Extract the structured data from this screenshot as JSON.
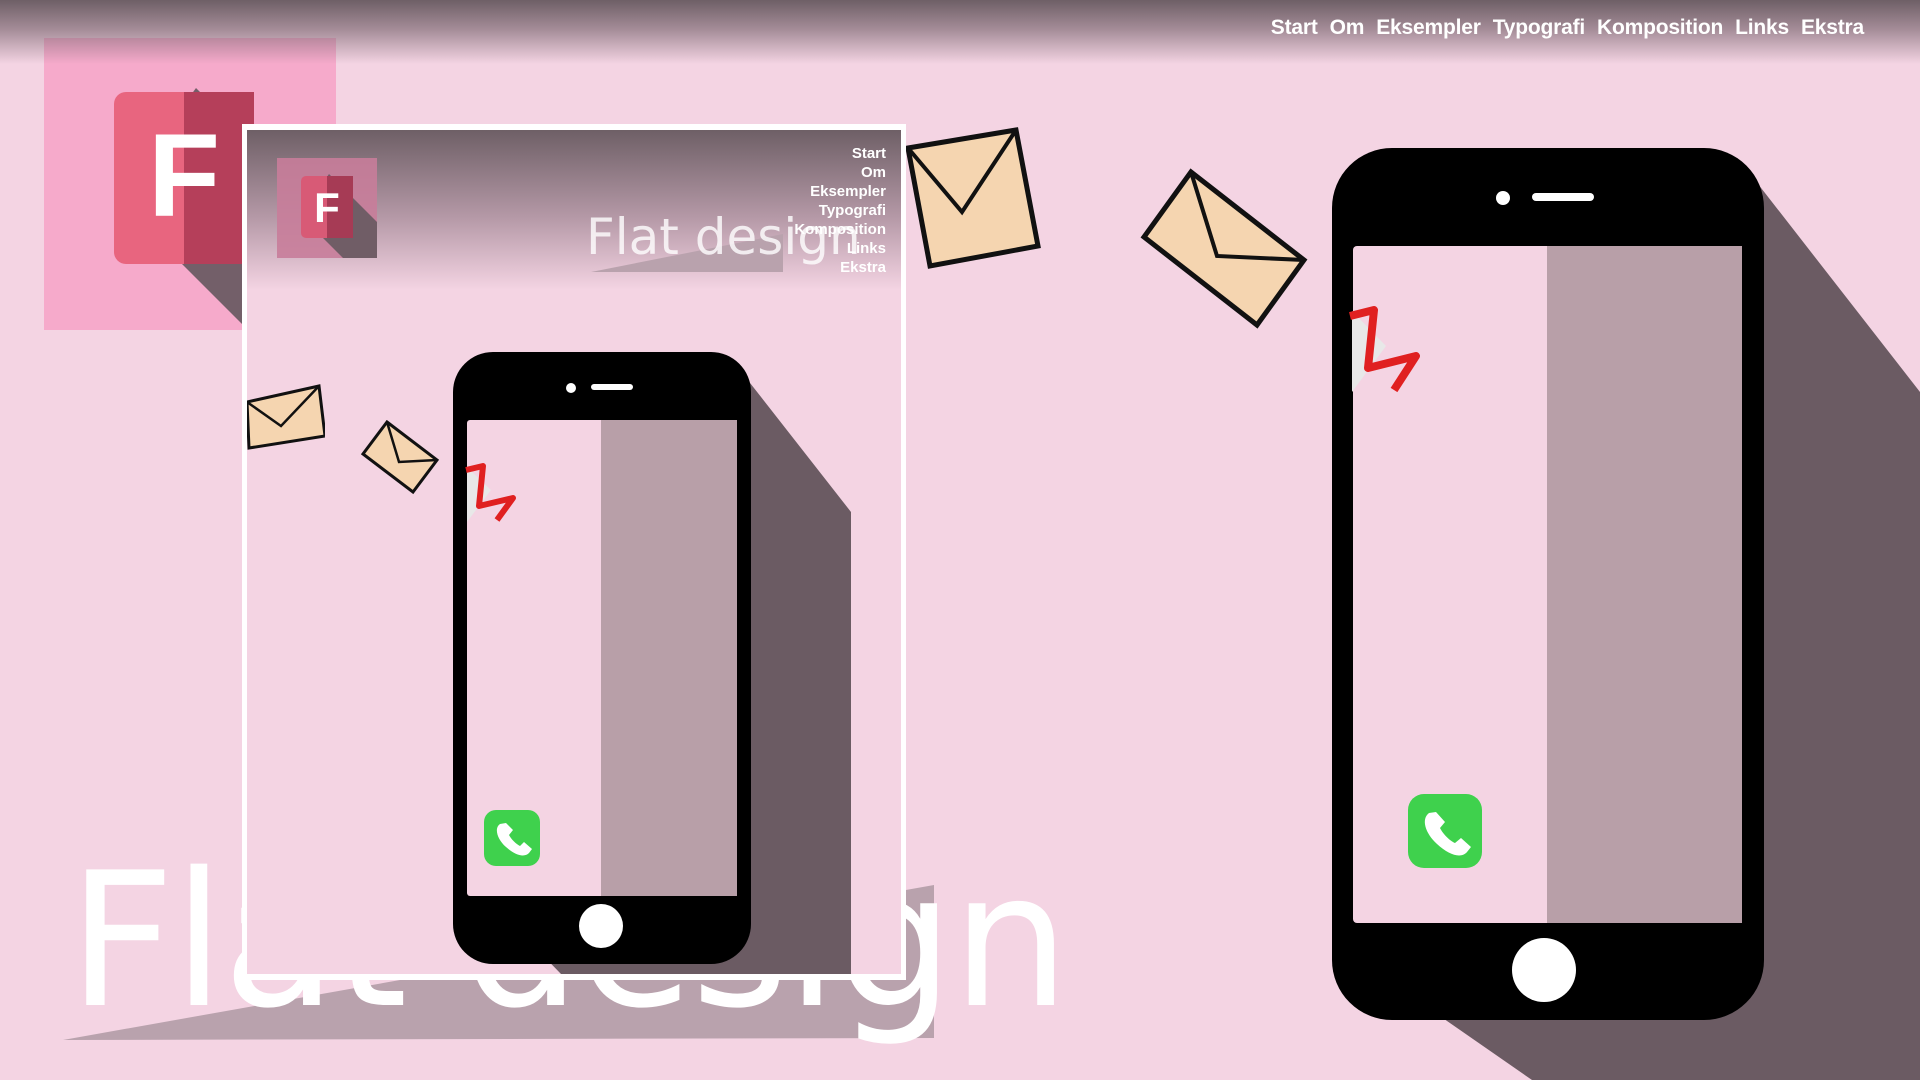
{
  "nav": {
    "items": [
      "Start",
      "Om",
      "Eksempler",
      "Typografi",
      "Komposition",
      "Links",
      "Ekstra"
    ]
  },
  "hero": {
    "title": "Flat design"
  },
  "logo": {
    "letter": "F"
  },
  "icons": {
    "logo": "letter-f-logo-icon",
    "smartphone": "smartphone-icon",
    "envelope": "envelope-icon",
    "gmail": "gmail-icon",
    "phone": "phone-call-icon"
  },
  "colors": {
    "background": "#f4d4e3",
    "shadow": "#6b5b63",
    "accent_red": "#e0627c",
    "phone_green": "#3fd14d",
    "envelope": "#f5d5b0"
  },
  "preview": {
    "nav": {
      "items": [
        "Start",
        "Om",
        "Eksempler",
        "Typografi",
        "Komposition",
        "Links",
        "Ekstra"
      ]
    },
    "title": "Flat design",
    "logo_letter": "F"
  }
}
